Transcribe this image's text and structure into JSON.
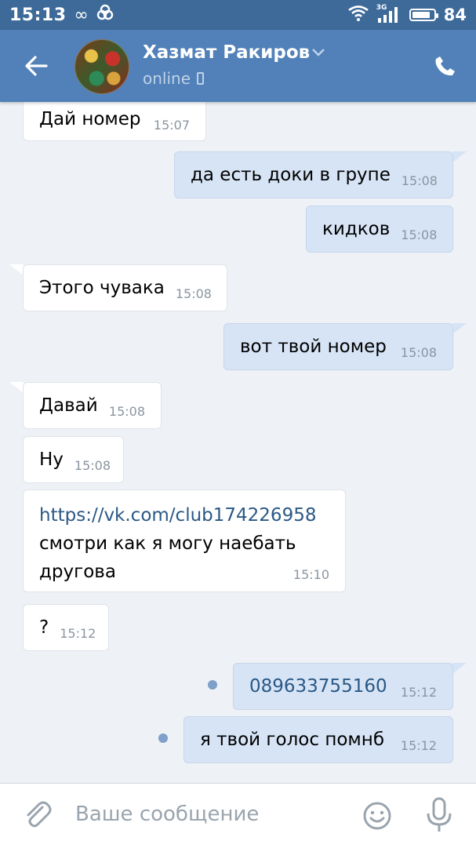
{
  "status_bar": {
    "time": "15:13",
    "network_label": "3G",
    "battery_percent": "84",
    "battery_level": 0.84,
    "icons": [
      "infinity-icon",
      "link-icon",
      "wifi-icon",
      "signal-icon",
      "battery-icon"
    ]
  },
  "header": {
    "contact_name": "Хазмат Ракиров",
    "status": "online",
    "icons": [
      "back-arrow-icon",
      "chevron-down-icon",
      "mobile-icon",
      "phone-icon"
    ]
  },
  "messages": [
    {
      "direction": "in",
      "text": "Дай номер",
      "time": "15:07"
    },
    {
      "direction": "out",
      "text": "да есть доки в групе",
      "time": "15:08"
    },
    {
      "direction": "out",
      "text": "кидков",
      "time": "15:08"
    },
    {
      "direction": "in",
      "text": "Этого чувака",
      "time": "15:08"
    },
    {
      "direction": "out",
      "text": "вот твой номер",
      "time": "15:08"
    },
    {
      "direction": "in",
      "text": "Давай",
      "time": "15:08"
    },
    {
      "direction": "in",
      "text": "Ну",
      "time": "15:08"
    },
    {
      "direction": "in",
      "link": "https://vk.com/club174226958",
      "lines": [
        "смотри как я могу наебать",
        "другова"
      ],
      "time": "15:10"
    },
    {
      "direction": "in",
      "text": "?",
      "time": "15:12"
    },
    {
      "direction": "out",
      "text": "089633755160",
      "time": "15:12",
      "unread": true
    },
    {
      "direction": "out",
      "text": "я твой голос помнб",
      "time": "15:12",
      "unread": true
    }
  ],
  "input_bar": {
    "placeholder": "Ваше сообщение",
    "icons": [
      "paperclip-icon",
      "emoji-icon",
      "microphone-icon"
    ]
  },
  "colors": {
    "status_bar": "#3d6a99",
    "header": "#5181b8",
    "background": "#eef1f5",
    "incoming_bubble": "#ffffff",
    "outgoing_bubble": "#d6e4f6",
    "link": "#2a5885",
    "unread_dot": "#7ea0c9"
  }
}
